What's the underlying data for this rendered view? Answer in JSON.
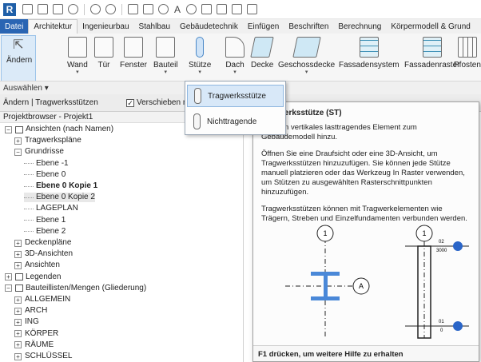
{
  "tabs": [
    "Datei",
    "Architektur",
    "Ingenieurbau",
    "Stahlbau",
    "Gebäudetechnik",
    "Einfügen",
    "Beschriften",
    "Berechnung",
    "Körpermodell & Grund"
  ],
  "ribbon": {
    "buttons": [
      "Ändern",
      "Wand",
      "Tür",
      "Fenster",
      "Bauteil",
      "Stütze",
      "Dach",
      "Decke",
      "Geschossdecke",
      "Fassadensystem",
      "Fassadenraster",
      "Pfosten"
    ],
    "footer": "Auswählen ▾"
  },
  "options_bar": {
    "context": "Ändern | Tragwerksstützen",
    "checkbox_label": "Verschieben m",
    "checkbox_mark": "✓"
  },
  "dropdown": {
    "items": [
      "Tragwerksstütze",
      "Nichttragende"
    ]
  },
  "tooltip": {
    "title": "Tragwerksstütze (ST)",
    "p1": "Fügt ein vertikales lasttragendes Element zum Gebäudemodell hinzu.",
    "p2": "Öffnen Sie eine Draufsicht oder eine 3D-Ansicht, um Tragwerksstützen hinzuzufügen. Sie können jede Stütze manuell platzieren oder das Werkzeug In Raster verwenden, um Stützen zu ausgewählten Rasterschnittpunkten hinzuzufügen.",
    "p3": "Tragwerksstützen können mit Tragwerkelementen wie Trägern, Streben und Einzelfundamenten verbunden werden.",
    "fig_labels": {
      "a": "1",
      "b": "A",
      "c": "1",
      "d1": "02",
      "d2": "3000",
      "e1": "01",
      "e2": "0"
    },
    "footer": "F1 drücken, um weitere Hilfe zu erhalten"
  },
  "browser": {
    "title": "Projektbrowser - Projekt1",
    "rows": [
      {
        "label": "Ansichten (nach Namen)",
        "exp": "−",
        "indent": 0,
        "bold": false,
        "sel": false,
        "icon": true
      },
      {
        "label": "Tragwerkspläne",
        "exp": "+",
        "indent": 1,
        "bold": false,
        "sel": false,
        "icon": false
      },
      {
        "label": "Grundrisse",
        "exp": "−",
        "indent": 1,
        "bold": false,
        "sel": false,
        "icon": false
      },
      {
        "label": "Ebene -1",
        "exp": "",
        "indent": 2,
        "bold": false,
        "sel": false,
        "icon": false
      },
      {
        "label": "Ebene 0",
        "exp": "",
        "indent": 2,
        "bold": false,
        "sel": false,
        "icon": false
      },
      {
        "label": "Ebene 0 Kopie 1",
        "exp": "",
        "indent": 2,
        "bold": true,
        "sel": false,
        "icon": false
      },
      {
        "label": "Ebene 0 Kopie 2",
        "exp": "",
        "indent": 2,
        "bold": false,
        "sel": true,
        "icon": false
      },
      {
        "label": "LAGEPLAN",
        "exp": "",
        "indent": 2,
        "bold": false,
        "sel": false,
        "icon": false
      },
      {
        "label": "Ebene 1",
        "exp": "",
        "indent": 2,
        "bold": false,
        "sel": false,
        "icon": false
      },
      {
        "label": "Ebene 2",
        "exp": "",
        "indent": 2,
        "bold": false,
        "sel": false,
        "icon": false
      },
      {
        "label": "Deckenpläne",
        "exp": "+",
        "indent": 1,
        "bold": false,
        "sel": false,
        "icon": false
      },
      {
        "label": "3D-Ansichten",
        "exp": "+",
        "indent": 1,
        "bold": false,
        "sel": false,
        "icon": false
      },
      {
        "label": "Ansichten",
        "exp": "+",
        "indent": 1,
        "bold": false,
        "sel": false,
        "icon": false
      },
      {
        "label": "Legenden",
        "exp": "+",
        "indent": 0,
        "bold": false,
        "sel": false,
        "icon": true
      },
      {
        "label": "Bauteillisten/Mengen (Gliederung)",
        "exp": "−",
        "indent": 0,
        "bold": false,
        "sel": false,
        "icon": true
      },
      {
        "label": "ALLGEMEIN",
        "exp": "+",
        "indent": 1,
        "bold": false,
        "sel": false,
        "icon": false
      },
      {
        "label": "ARCH",
        "exp": "+",
        "indent": 1,
        "bold": false,
        "sel": false,
        "icon": false
      },
      {
        "label": "ING",
        "exp": "+",
        "indent": 1,
        "bold": false,
        "sel": false,
        "icon": false
      },
      {
        "label": "KÖRPER",
        "exp": "+",
        "indent": 1,
        "bold": false,
        "sel": false,
        "icon": false
      },
      {
        "label": "RÄUME",
        "exp": "+",
        "indent": 1,
        "bold": false,
        "sel": false,
        "icon": false
      },
      {
        "label": "SCHLÜSSEL",
        "exp": "+",
        "indent": 1,
        "bold": false,
        "sel": false,
        "icon": false
      }
    ]
  }
}
